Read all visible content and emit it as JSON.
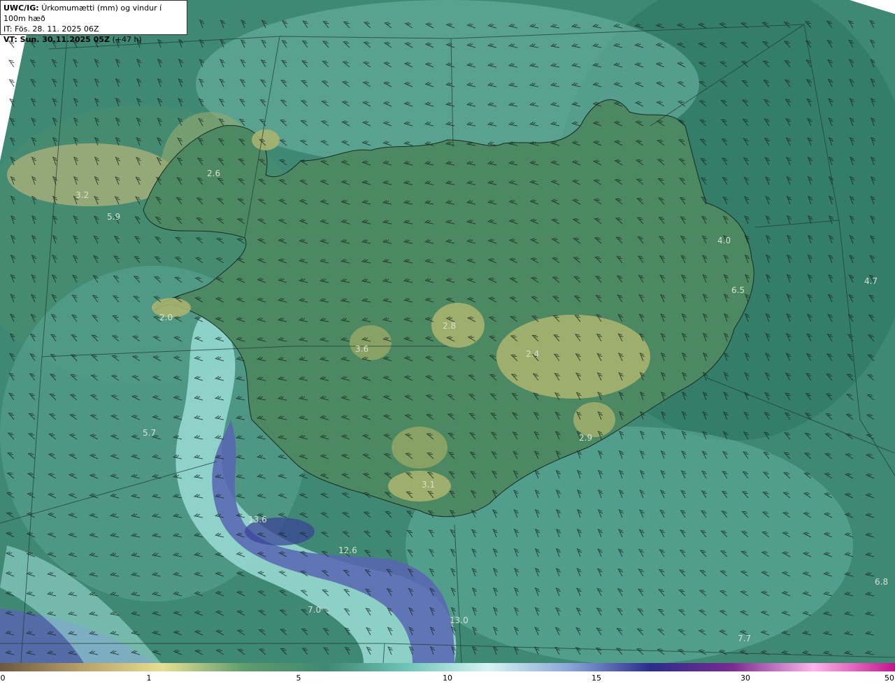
{
  "header": {
    "title_bold": "UWC/IG:",
    "title_text": "Úrkomumætti (mm) og vindur í 100m hæð",
    "it_line": "IT: Fös. 28. 11. 2025 06Z",
    "vt_bold": "VT: Sun. 30.11.2025 05Z",
    "vt_offset": "(+47 h)"
  },
  "map_values": [
    "3.2",
    "5.9",
    "2.6",
    "2.0",
    "3.6",
    "2.8",
    "4.0",
    "6.5",
    "4.7",
    "2.9",
    "5.7",
    "3.1",
    "13.6",
    "12.6",
    "7.0",
    "13.0",
    "7.7",
    "6.8",
    "2.4"
  ],
  "colorbar": {
    "ticks": [
      "0",
      "1",
      "5",
      "10",
      "15",
      "30",
      "50"
    ],
    "colors": [
      "#6b5840",
      "#b8a068",
      "#e6df92",
      "#5f9c6c",
      "#3f8873",
      "#6fc4b8",
      "#d6f4f2",
      "#8aa6d8",
      "#2a2c8c",
      "#7a2b90",
      "#ffb4ea",
      "#c3148c"
    ]
  },
  "colors": {
    "sea_base": "#3f8873",
    "land": "#4e8a63",
    "highland": "#a4b070",
    "heavy_precip": "#5966b8",
    "moderate_precip": "#8ad6d0"
  }
}
